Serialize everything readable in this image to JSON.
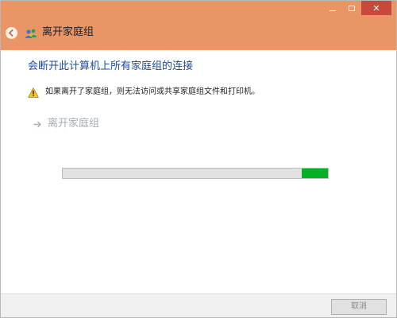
{
  "window": {
    "title": "离开家庭组",
    "caption_buttons": {
      "minimize": "–",
      "maximize": "□",
      "close": "✕"
    }
  },
  "content": {
    "heading": "会断开此计算机上所有家庭组的连接",
    "warning": "如果离开了家庭组，则无法访问或共享家庭组文件和打印机。",
    "leave_link": "离开家庭组",
    "progress": {
      "state": "indeterminate",
      "fill_color": "#06b025"
    }
  },
  "footer": {
    "cancel_label": "取消"
  },
  "colors": {
    "titlebar": "#ea9566",
    "heading": "#1e4a9c",
    "close_button": "#c9483c",
    "disabled_text": "#a8adb6"
  },
  "icons": {
    "back": "back-arrow-icon",
    "title": "homegroup-icon",
    "warning": "warning-icon",
    "leave": "arrow-right-icon"
  }
}
